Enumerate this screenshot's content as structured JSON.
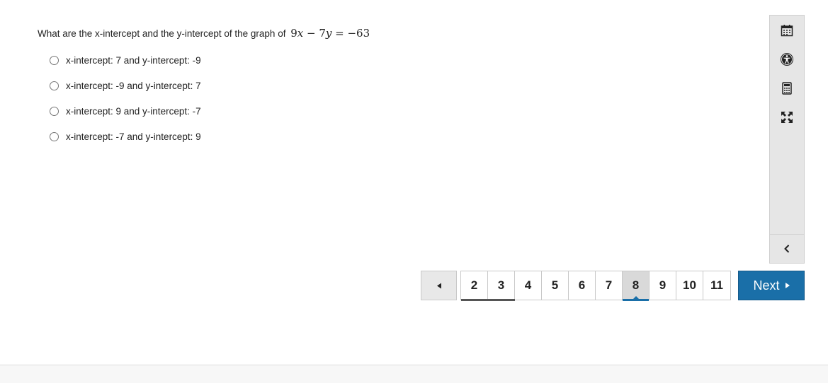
{
  "question": {
    "text": "What are the x-intercept and the y-intercept of the graph of",
    "equation": {
      "a": "9",
      "x": "x",
      "minus": " − ",
      "b": "7",
      "y": "y",
      "equals": " = ",
      "c": "−63"
    }
  },
  "options": [
    {
      "label": "x-intercept: 7 and y-intercept: -9",
      "selected": false
    },
    {
      "label": "x-intercept: -9 and y-intercept: 7",
      "selected": false
    },
    {
      "label": "x-intercept: 9 and y-intercept: -7",
      "selected": false
    },
    {
      "label": "x-intercept: -7 and y-intercept: 9",
      "selected": false
    }
  ],
  "toolbar": {
    "tools": [
      "calendar-icon",
      "accessibility-icon",
      "calculator-icon",
      "fullscreen-icon"
    ],
    "collapse_icon": "chevron-left-icon"
  },
  "pagination": {
    "pages": [
      "2",
      "3",
      "4",
      "5",
      "6",
      "7",
      "8",
      "9",
      "10",
      "11"
    ],
    "current": "8",
    "visited": [
      "2",
      "3"
    ]
  },
  "next_label": "Next",
  "colors": {
    "accent": "#1a6fa8",
    "toolbar_bg": "#e6e6e6",
    "current_page_bg": "#d9d9d9"
  }
}
